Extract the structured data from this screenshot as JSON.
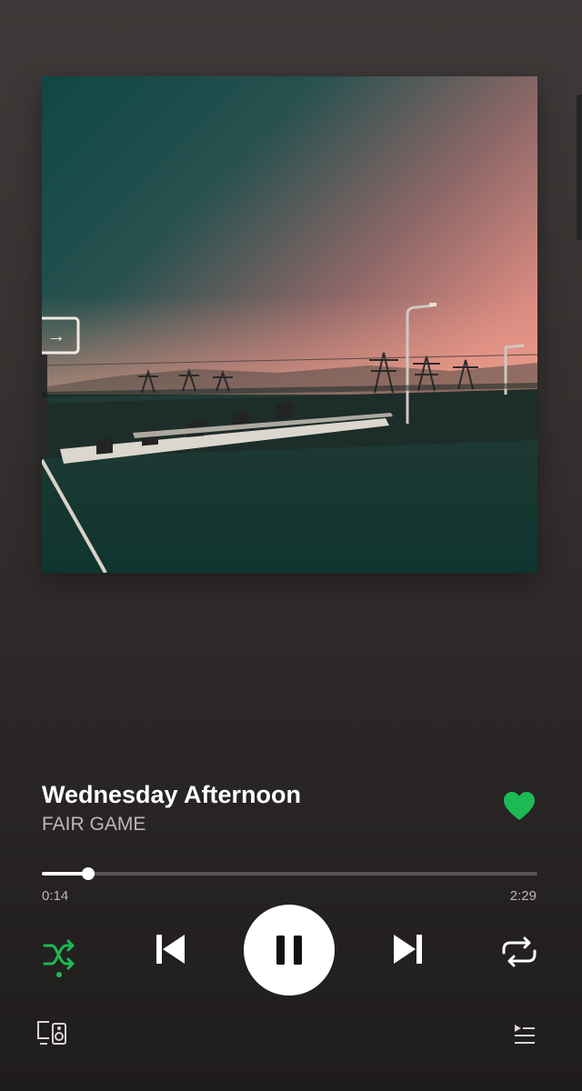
{
  "track": {
    "title": "Wednesday Afternoon",
    "artist": "FAIR GAME",
    "liked": true
  },
  "playback": {
    "elapsed": "0:14",
    "duration": "2:29",
    "progress_fraction": 0.094,
    "state": "playing",
    "shuffle": true
  },
  "album_art": {
    "sign_text": "→"
  },
  "icons": {
    "like": "heart-icon",
    "shuffle": "shuffle-icon",
    "previous": "skip-previous-icon",
    "pause": "pause-icon",
    "next": "skip-next-icon",
    "repeat": "repeat-icon",
    "devices": "devices-icon",
    "queue": "queue-icon"
  },
  "colors": {
    "accent": "#1db954",
    "text_primary": "#ffffff",
    "text_secondary": "#bdb7b6",
    "background": "#2f2a2a"
  }
}
